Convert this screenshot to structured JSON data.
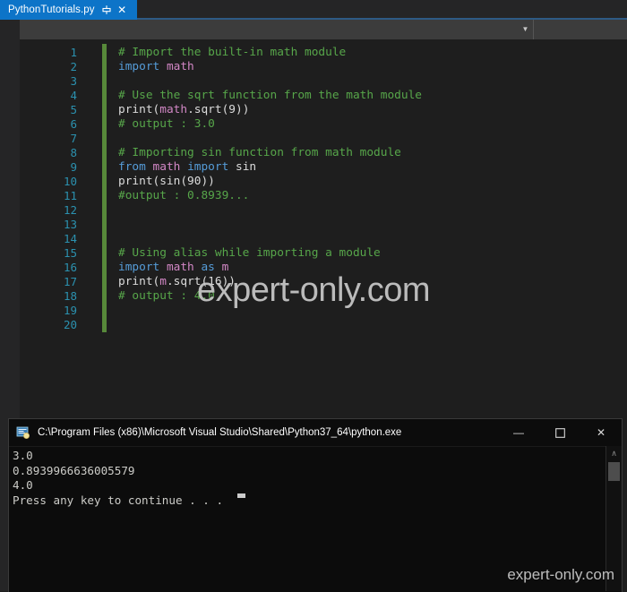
{
  "ide": {
    "tab": {
      "filename": "PythonTutorials.py",
      "pin_icon": "pin-icon",
      "close_icon": "close-icon",
      "active_color": "#0d74c8"
    },
    "navbar": {
      "chevron_icon": "chevron-down-icon"
    },
    "editor": {
      "background": "#1e1e1e",
      "line_number_color": "#2b91af",
      "change_bar_color": "#57893a",
      "line_numbers": [
        1,
        2,
        3,
        4,
        5,
        6,
        7,
        8,
        9,
        10,
        11,
        12,
        13,
        14,
        15,
        16,
        17,
        18,
        19,
        20
      ],
      "lines": [
        {
          "n": 1,
          "tokens": [
            {
              "t": "# Import the built-in math module",
              "c": "comment"
            }
          ]
        },
        {
          "n": 2,
          "tokens": [
            {
              "t": "import ",
              "c": "keyword"
            },
            {
              "t": "math",
              "c": "module"
            }
          ]
        },
        {
          "n": 3,
          "tokens": []
        },
        {
          "n": 4,
          "tokens": [
            {
              "t": "# Use the sqrt function from the math module",
              "c": "comment"
            }
          ]
        },
        {
          "n": 5,
          "tokens": [
            {
              "t": "print(",
              "c": "plain"
            },
            {
              "t": "math",
              "c": "module"
            },
            {
              "t": ".sqrt(",
              "c": "plain"
            },
            {
              "t": "9",
              "c": "plain"
            },
            {
              "t": "))",
              "c": "plain"
            }
          ]
        },
        {
          "n": 6,
          "tokens": [
            {
              "t": "# output : 3.0",
              "c": "comment"
            }
          ]
        },
        {
          "n": 7,
          "tokens": []
        },
        {
          "n": 8,
          "tokens": [
            {
              "t": "# Importing sin function from math module",
              "c": "comment"
            }
          ]
        },
        {
          "n": 9,
          "tokens": [
            {
              "t": "from ",
              "c": "keyword"
            },
            {
              "t": "math ",
              "c": "module"
            },
            {
              "t": "import ",
              "c": "keyword"
            },
            {
              "t": "sin",
              "c": "plain"
            }
          ]
        },
        {
          "n": 10,
          "tokens": [
            {
              "t": "print(sin(90))",
              "c": "plain"
            }
          ]
        },
        {
          "n": 11,
          "tokens": [
            {
              "t": "#output : 0.8939...",
              "c": "comment"
            }
          ]
        },
        {
          "n": 12,
          "tokens": []
        },
        {
          "n": 13,
          "tokens": []
        },
        {
          "n": 14,
          "tokens": []
        },
        {
          "n": 15,
          "tokens": [
            {
              "t": "# Using alias while importing a module",
              "c": "comment"
            }
          ]
        },
        {
          "n": 16,
          "tokens": [
            {
              "t": "import ",
              "c": "keyword"
            },
            {
              "t": "math ",
              "c": "module"
            },
            {
              "t": "as ",
              "c": "keyword"
            },
            {
              "t": "m",
              "c": "module"
            }
          ]
        },
        {
          "n": 17,
          "tokens": [
            {
              "t": "print(",
              "c": "plain"
            },
            {
              "t": "m",
              "c": "module"
            },
            {
              "t": ".sqrt(16))",
              "c": "plain"
            }
          ]
        },
        {
          "n": 18,
          "tokens": [
            {
              "t": "# output : 4.0",
              "c": "comment"
            }
          ]
        },
        {
          "n": 19,
          "tokens": []
        },
        {
          "n": 20,
          "tokens": []
        }
      ]
    },
    "watermark": "expert-only.com"
  },
  "console": {
    "title": "C:\\Program Files (x86)\\Microsoft Visual Studio\\Shared\\Python37_64\\python.exe",
    "icon": "console-app-icon",
    "window_controls": {
      "minimize": "—",
      "maximize": "❑",
      "close": "✕"
    },
    "output_lines": [
      "3.0",
      "0.8939966636005579",
      "4.0",
      "Press any key to continue . . ."
    ],
    "scrollbar": {
      "up_arrow": "∧"
    }
  },
  "page_watermark": "expert-only.com"
}
